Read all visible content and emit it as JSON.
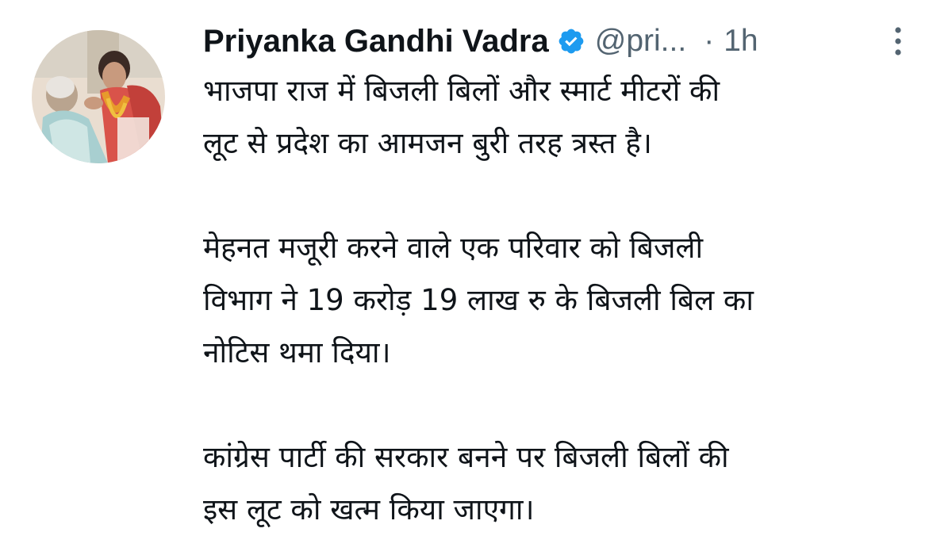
{
  "tweet": {
    "author": {
      "name": "Priyanka Gandhi Vadra",
      "handle": "@pri...",
      "verified": true
    },
    "separator": "·",
    "time": "1h",
    "paragraphs": [
      "भाजपा राज में बिजली बिलों और स्मार्ट मीटरों की\nलूट से प्रदेश का आमजन बुरी तरह त्रस्त है।",
      "मेहनत मजूरी करने वाले एक परिवार को बिजली\nविभाग ने 19 करोड़ 19 लाख रु के बिजली बिल का\nनोटिस थमा दिया।",
      "कांग्रेस पार्टी की सरकार बनने पर बिजली बिलों की\nइस लूट को खत्म किया जाएगा।"
    ]
  },
  "icons": {
    "verified": "verified-badge-icon",
    "more": "more-options-icon"
  },
  "colors": {
    "text": "#0f1419",
    "secondary": "#536471",
    "verified_blue": "#1d9bf0",
    "background": "#ffffff"
  }
}
